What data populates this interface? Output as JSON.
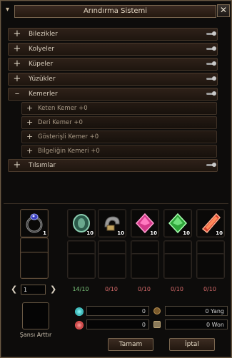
{
  "window": {
    "title": "Arındırma Sistemi"
  },
  "categories": [
    {
      "label": "Bilezikler",
      "sign": "+"
    },
    {
      "label": "Kolyeler",
      "sign": "+"
    },
    {
      "label": "Küpeler",
      "sign": "+"
    },
    {
      "label": "Yüzükler",
      "sign": "+"
    },
    {
      "label": "Kemerler",
      "sign": "–"
    }
  ],
  "subitems": [
    {
      "label": "Keten Kemer +0",
      "sign": "+"
    },
    {
      "label": "Deri Kemer +0",
      "sign": "+"
    },
    {
      "label": "Gösterişli Kemer +0",
      "sign": "+"
    },
    {
      "label": "Bilgeliğin Kemeri +0",
      "sign": "+"
    }
  ],
  "last_category": {
    "label": "Tılsımlar",
    "sign": "+"
  },
  "main_slot": {
    "icon": "ring-icon",
    "qty": "1"
  },
  "materials": [
    {
      "icon": "green-scroll-icon",
      "qty": "10",
      "count": "14/10",
      "count_color": "#7cc77c"
    },
    {
      "icon": "grey-hook-icon",
      "qty": "10",
      "count": "0/10",
      "count_color": "#d86b6b"
    },
    {
      "icon": "pink-gem-icon",
      "qty": "10",
      "count": "0/10",
      "count_color": "#d86b6b"
    },
    {
      "icon": "green-gem-icon",
      "qty": "10",
      "count": "0/10",
      "count_color": "#d86b6b"
    },
    {
      "icon": "red-crystal-icon",
      "qty": "10",
      "count": "0/10",
      "count_color": "#d86b6b"
    }
  ],
  "pagination": {
    "page": "1"
  },
  "chance": {
    "label": "Şansı Arttır"
  },
  "fields": {
    "left_top": "0",
    "left_bottom": "0",
    "yang": "0 Yang",
    "won": "0 Won"
  },
  "buttons": {
    "ok": "Tamam",
    "cancel": "İptal"
  }
}
